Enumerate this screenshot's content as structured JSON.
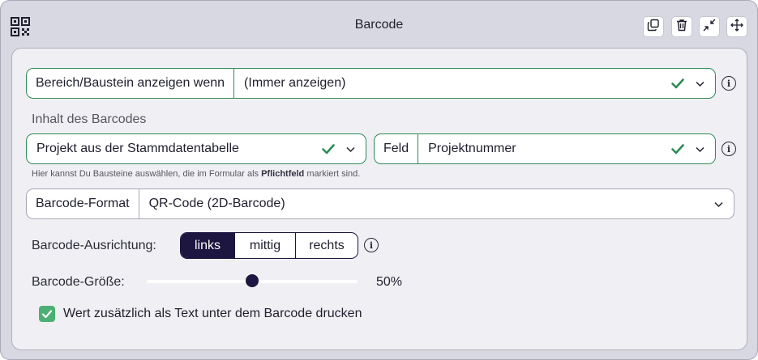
{
  "window": {
    "title": "Barcode",
    "icons": [
      "qr-code-icon",
      "duplicate-icon",
      "trash-icon",
      "collapse-icon",
      "move-icon"
    ]
  },
  "visibility": {
    "label": "Bereich/Baustein anzeigen wenn",
    "value": "(Immer anzeigen)"
  },
  "content": {
    "section_label": "Inhalt des Barcodes",
    "source_value": "Projekt aus der Stammdatentabelle",
    "field_label": "Feld",
    "field_value": "Projektnummer",
    "hint_prefix": "Hier kannst Du Bausteine auswählen, die im Formular als",
    "hint_bold": "Pflichtfeld",
    "hint_suffix": "markiert sind."
  },
  "format": {
    "label": "Barcode-Format",
    "value": "QR-Code (2D-Barcode)"
  },
  "alignment": {
    "label": "Barcode-Ausrichtung:",
    "options": [
      "links",
      "mittig",
      "rechts"
    ],
    "selected": "links"
  },
  "size": {
    "label": "Barcode-Größe:",
    "value_text": "50%",
    "value_fraction": 0.5
  },
  "print_text": {
    "label": "Wert zusätzlich als Text unter dem Barcode drucken",
    "checked": true
  },
  "colors": {
    "accent_dark": "#1c1640",
    "success_green": "#2e8b57",
    "checkbox_green": "#4caf73"
  }
}
